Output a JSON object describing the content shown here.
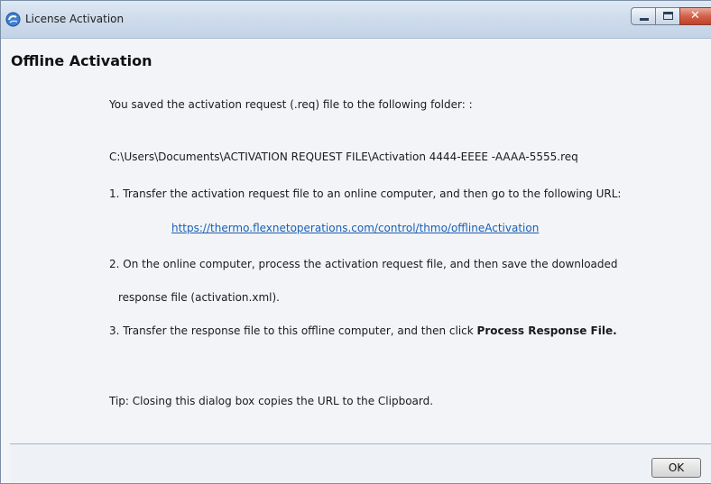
{
  "window": {
    "title": "License Activation"
  },
  "heading": "Offline Activation",
  "content": {
    "saved_msg": "You saved the activation request (.req) file to the following folder: :",
    "file_path": "C:\\Users\\Documents\\ACTIVATION REQUEST FILE\\Activation 4444-EEEE -AAAA-5555.req",
    "step1": "1. Transfer the activation request file to an online computer, and then go to the following URL:",
    "url": "https://thermo.flexnetoperations.com/control/thmo/offlineActivation",
    "step2_line1": "2. On the online computer, process the activation request file, and then save the downloaded",
    "step2_line2": "response file (activation.xml).",
    "step3_prefix": "3. Transfer the response file to this offline computer, and then click ",
    "step3_bold": "Process Response File.",
    "tip": "Tip: Closing this dialog box copies the URL to the Clipboard."
  },
  "footer": {
    "ok_label": "OK"
  },
  "icons": {
    "app": "license-activation-icon",
    "minimize": "minimize-icon",
    "maximize": "maximize-icon",
    "close": "close-icon"
  },
  "colors": {
    "link": "#1a5fb4",
    "close_button": "#c0412a"
  }
}
